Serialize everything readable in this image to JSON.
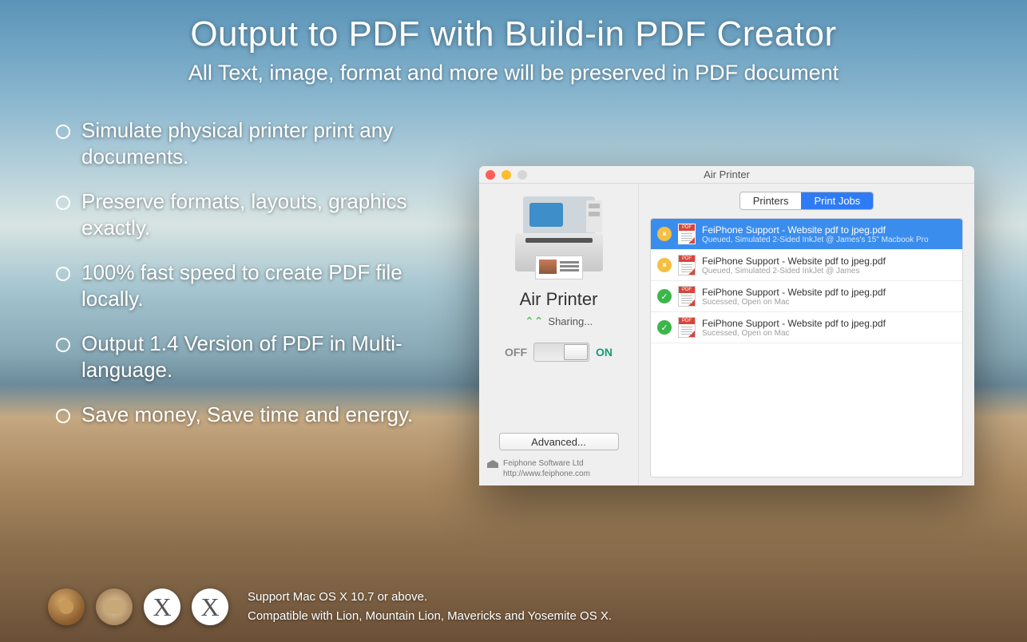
{
  "headline": {
    "title": "Output to PDF with Build-in PDF Creator",
    "subtitle": "All Text, image, format and more will be preserved in PDF document"
  },
  "bullets": [
    "Simulate physical printer print any documents.",
    "Preserve formats, layouts, graphics exactly.",
    "100% fast speed to create PDF file locally.",
    "Output 1.4 Version of PDF in Multi-language.",
    "Save money, Save time and energy."
  ],
  "window": {
    "title": "Air Printer",
    "app_name": "Air Printer",
    "sharing_label": "Sharing...",
    "toggle": {
      "off": "OFF",
      "on": "ON"
    },
    "advanced_label": "Advanced...",
    "company": {
      "name": "Feiphone Software Ltd",
      "url": "http://www.feiphone.com"
    },
    "tabs": {
      "printers": "Printers",
      "print_jobs": "Print Jobs"
    },
    "jobs": [
      {
        "title": "FeiPhone Support - Website pdf to jpeg.pdf",
        "sub": "Queued,   Simulated 2-Sided InkJet @ James's 15\" Macbook Pro",
        "status": "queued",
        "selected": true
      },
      {
        "title": "FeiPhone Support - Website pdf to jpeg.pdf",
        "sub": "Queued,   Simulated 2-Sided InkJet @ James",
        "status": "queued",
        "selected": false
      },
      {
        "title": "FeiPhone Support - Website pdf to jpeg.pdf",
        "sub": "Sucessed, Open on Mac",
        "status": "success",
        "selected": false
      },
      {
        "title": "FeiPhone Support - Website pdf to jpeg.pdf",
        "sub": "Sucessed, Open on Mac",
        "status": "success",
        "selected": false
      }
    ]
  },
  "footer": {
    "line1": "Support Mac OS X 10.7 or above.",
    "line2": "Compatible with Lion, Mountain Lion, Mavericks and Yosemite OS X."
  }
}
